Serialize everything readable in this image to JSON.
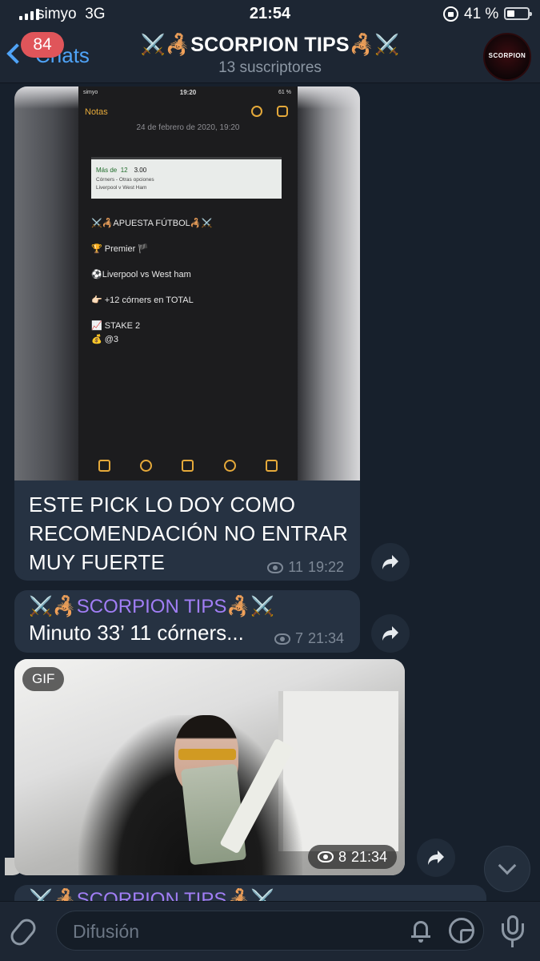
{
  "status_bar": {
    "carrier": "simyo",
    "network": "3G",
    "time": "21:54",
    "battery": "41 %"
  },
  "header": {
    "back_label": "Chats",
    "unread_count": "84",
    "title": "⚔️🦂SCORPION TIPS🦂⚔️",
    "subtitle": "13 suscriptores",
    "avatar_label": "SCORPION"
  },
  "messages": [
    {
      "type": "photo",
      "photo": {
        "status_carrier": "simyo",
        "status_time": "19:20",
        "status_battery": "61 %",
        "app_back": "Notas",
        "date": "24 de febrero de 2020, 19:20",
        "bet_card": {
          "line1_label": "Más de",
          "line1_value": "12",
          "line1_odds": "3.00",
          "line2": "Córners - Otras opciones",
          "line3": "Liverpool v West Ham"
        },
        "lines": [
          "⚔️🦂APUESTA FÚTBOL🦂⚔️",
          "🏆 Premier 🏴",
          "⚽Liverpool vs West ham",
          "👉🏻 +12 córners en TOTAL",
          "📈 STAKE 2",
          "💰 @3"
        ]
      },
      "text_lines": [
        "ESTE PICK LO DOY COMO",
        "RECOMENDACIÓN NO ENTRAR",
        "MUY FUERTE"
      ],
      "views": "11",
      "time": "19:22"
    },
    {
      "type": "text",
      "sender": "⚔️🦂SCORPION TIPS🦂⚔️",
      "text": "Minuto 33’ 11 córners...",
      "views": "7",
      "time": "21:34"
    },
    {
      "type": "gif",
      "badge": "GIF",
      "views": "8",
      "time": "21:34"
    },
    {
      "type": "text",
      "sender": "⚔️🦂SCORPION TIPS🦂⚔️"
    }
  ],
  "input": {
    "placeholder": "Difusión"
  },
  "colors": {
    "background": "#17202c",
    "bubble": "#263242",
    "accent_link": "#4fa3f7",
    "sender_name": "#a17ef5",
    "badge": "#e0555a",
    "muted": "#7d8896"
  }
}
